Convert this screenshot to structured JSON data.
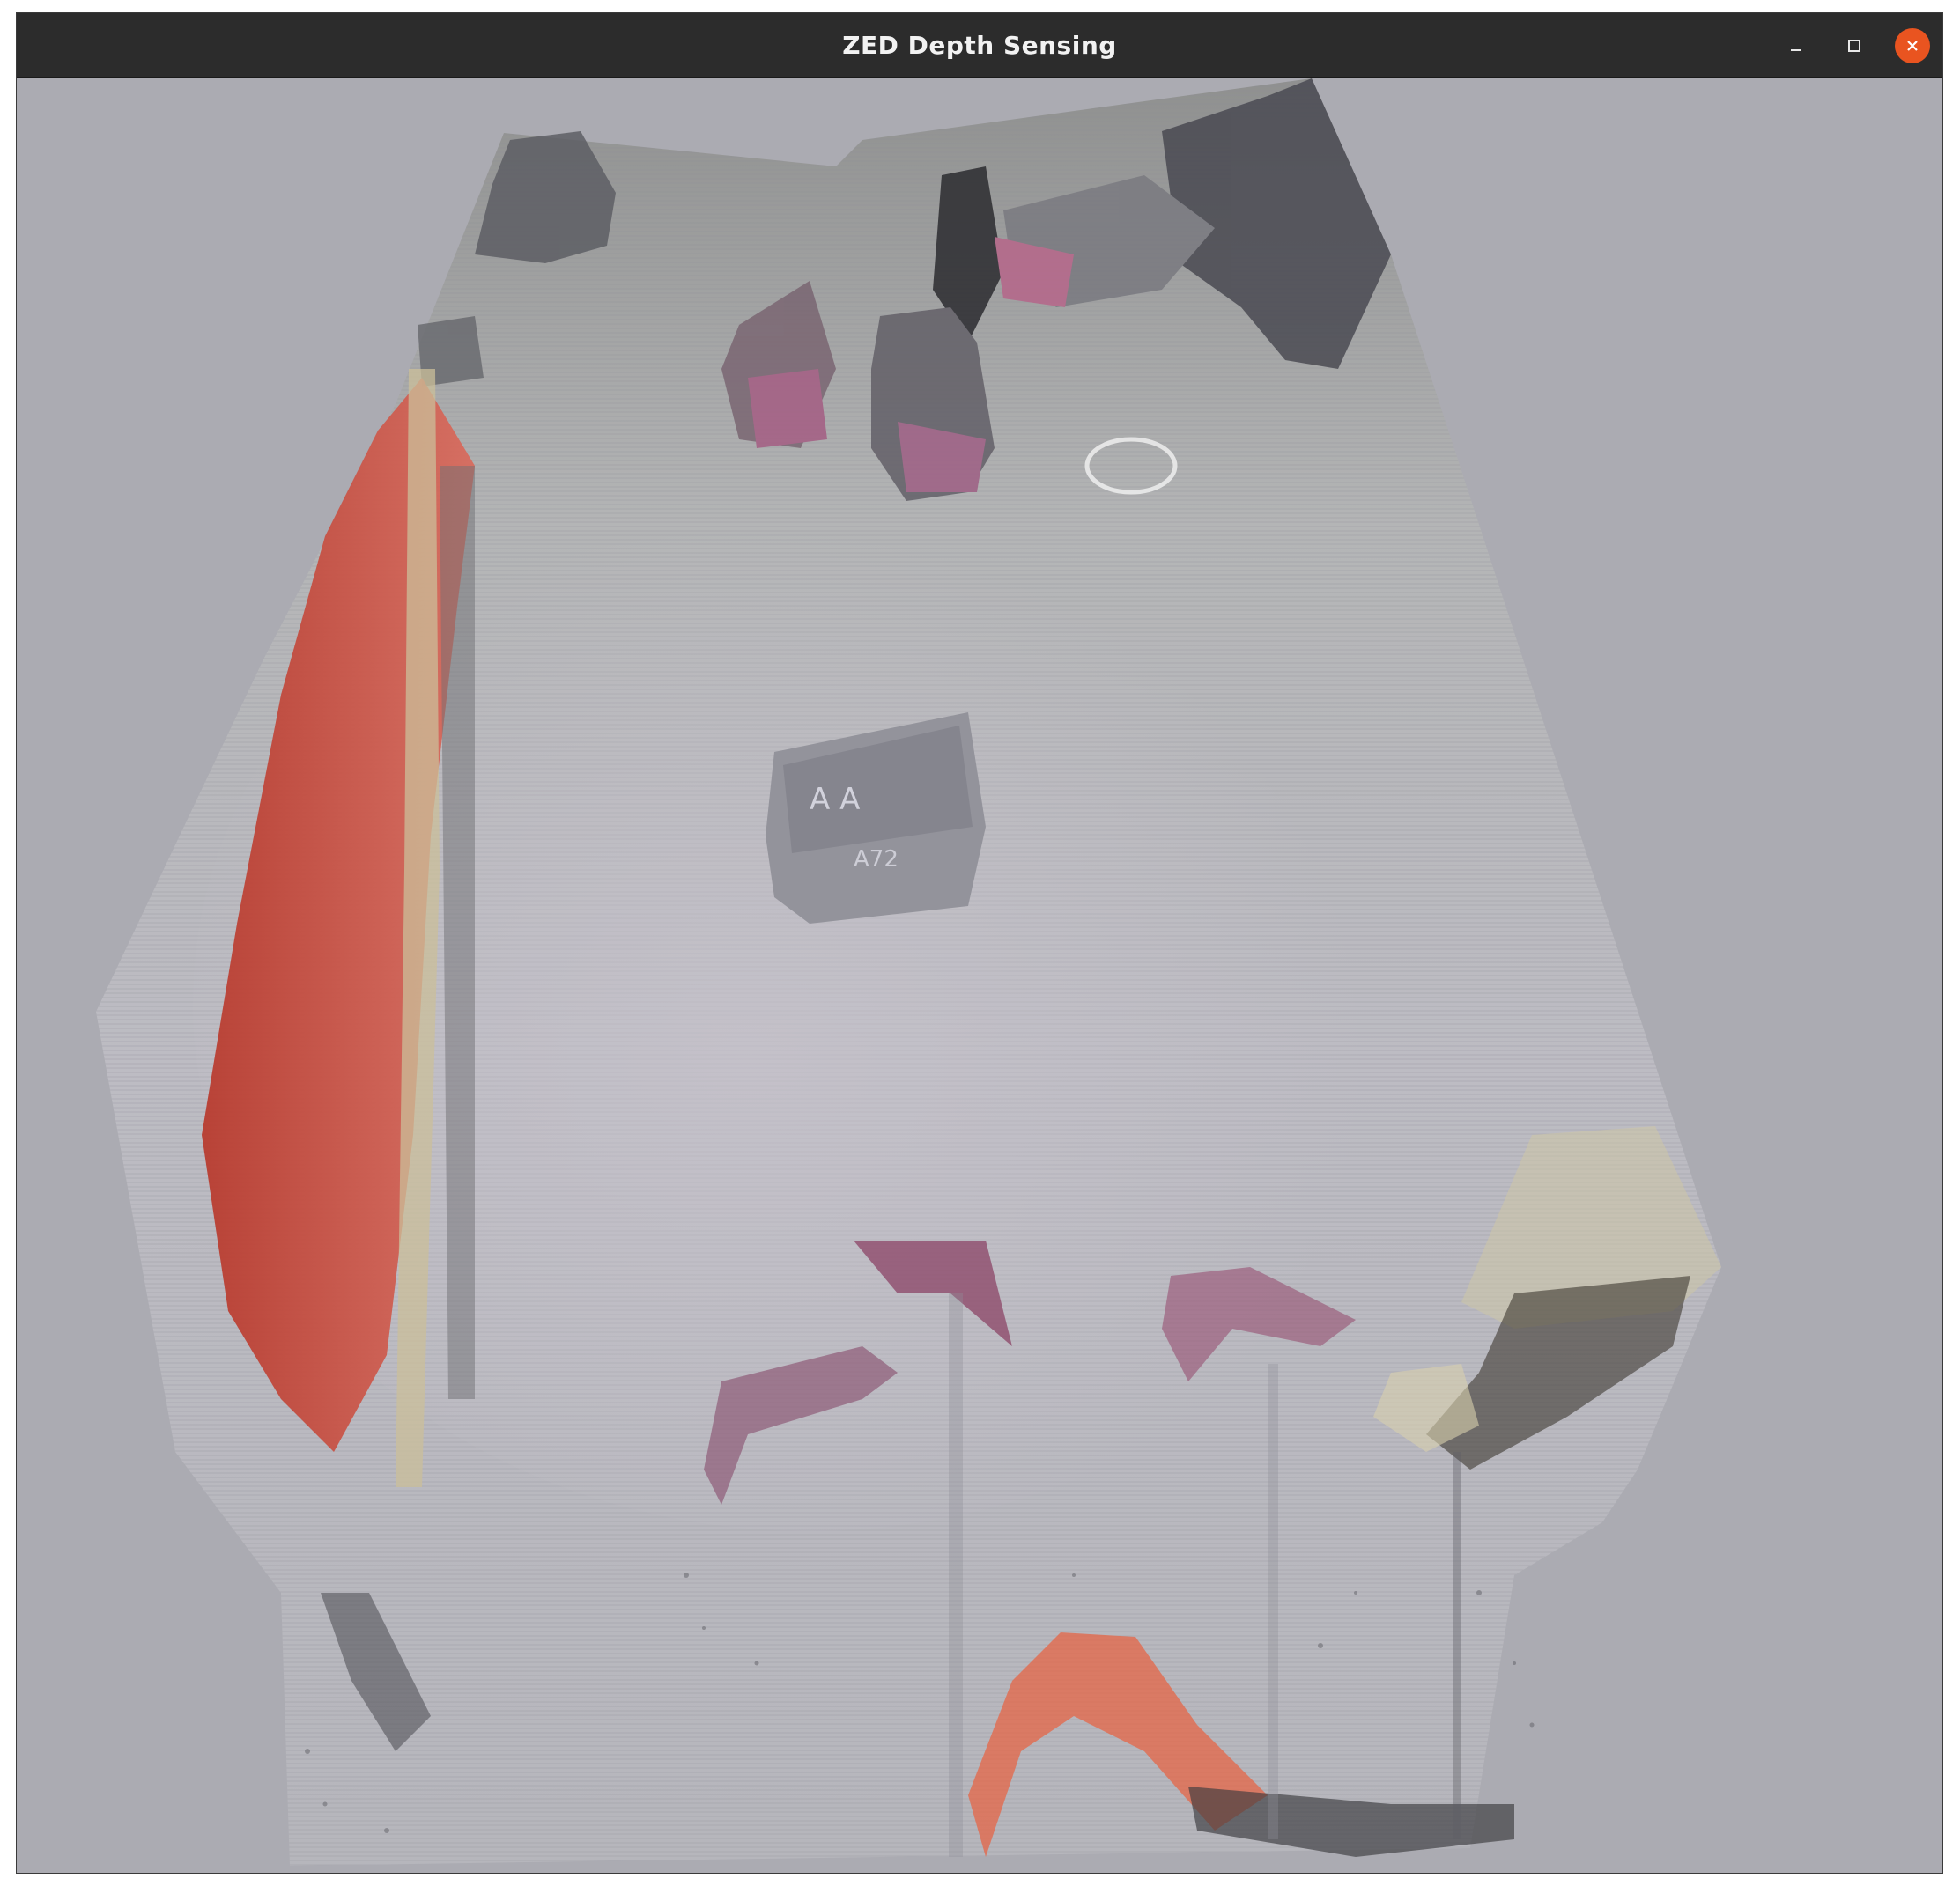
{
  "window": {
    "title": "ZED Depth Sensing",
    "controls": {
      "minimize_icon": "minimize-icon",
      "maximize_icon": "maximize-icon",
      "close_icon": "close-icon"
    }
  },
  "viewport": {
    "content": "point-cloud-render",
    "background_color": "#ababb2"
  },
  "colors": {
    "titlebar": "#2c2c2c",
    "close_button": "#e95420",
    "title_text": "#f2f2f2"
  }
}
